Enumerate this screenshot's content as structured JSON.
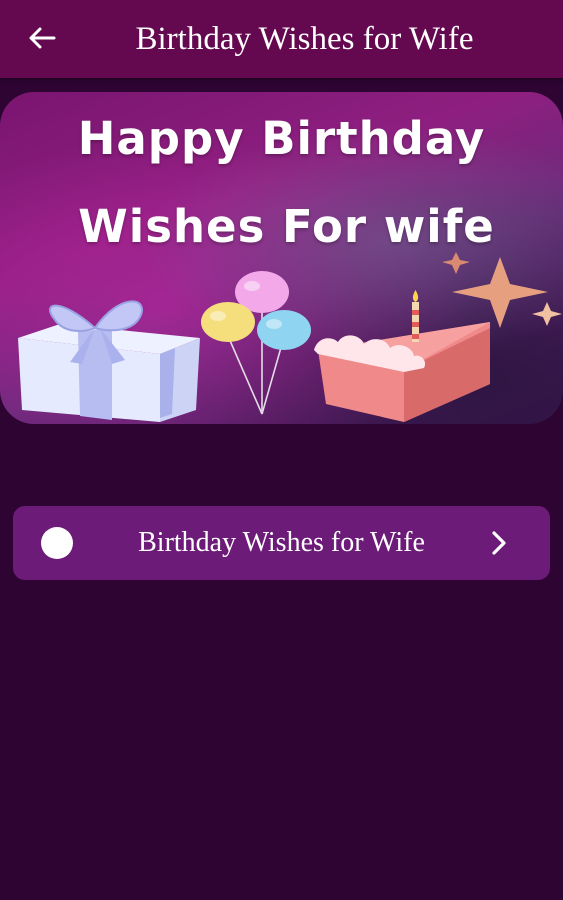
{
  "app_bar": {
    "title": "Birthday Wishes for Wife",
    "back_icon": "arrow-left-icon"
  },
  "banner": {
    "line1": "Happy Birthday",
    "line2": "Wishes For wife"
  },
  "list": {
    "items": [
      {
        "label": "Birthday Wishes for Wife",
        "icon": "chevron-right-icon"
      }
    ]
  },
  "colors": {
    "app_bar": "#64094f",
    "background": "#2e0532",
    "list_item": "#6c1b78"
  }
}
